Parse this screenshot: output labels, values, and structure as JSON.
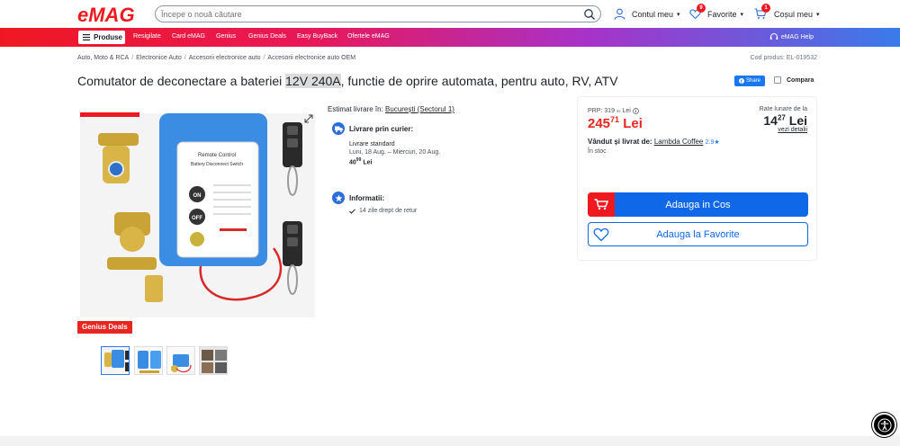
{
  "header": {
    "search_placeholder": "Începe o nouă căutare",
    "account_label": "Contul meu",
    "favorites_label": "Favorite",
    "favorites_count": "9",
    "cart_label": "Coșul meu",
    "cart_count": "1"
  },
  "nav": {
    "products_label": "Produse",
    "links": [
      "Resigilate",
      "Card eMAG",
      "Genius",
      "Genius Deals",
      "Easy BuyBack",
      "Ofertele eMAG"
    ],
    "help_label": "eMAG Help"
  },
  "breadcrumb": [
    "Auto, Moto & RCA",
    "Electronice Auto",
    "Accesorii electronice auto",
    "Accesorii electronice auto OEM"
  ],
  "product_code": "Cod produs: EL-019532",
  "title": {
    "prefix": "Comutator de deconectare a bateriei ",
    "highlight": "12V 240A",
    "suffix": ", functie de oprire automata, pentru auto, RV, ATV"
  },
  "share_label": "Share",
  "compare_label": "Compara",
  "genius_deals_label": "Genius Deals",
  "delivery": {
    "estimate_label": "Estimat livrare în:",
    "estimate_location": "București (Sectorul 1)",
    "courier_title": "Livrare prin curier:",
    "standard_label": "Livrare standard",
    "dates": "Luni, 18 Aug. – Miercuri, 20 Aug.",
    "price_main": "40",
    "price_cents": "99",
    "price_currency": "Lei",
    "info_title": "Informatii:",
    "return_text": "14 zile drept de retur"
  },
  "pricing": {
    "prp_label": "PRP: 319",
    "prp_cents": "99",
    "prp_currency": "Lei",
    "price_main": "245",
    "price_cents": "71",
    "price_currency": "Lei",
    "rate_label": "Rate lunare de la",
    "rate_main": "14",
    "rate_cents": "27",
    "rate_currency": "Lei",
    "rate_link": "vezi detalii",
    "seller_label": "Vândut și livrat de:",
    "seller_name": "Lambda Coffee",
    "seller_rating": "2.9",
    "stock": "În stoc",
    "add_to_cart": "Adauga in Cos",
    "add_to_fav": "Adauga la Favorite"
  },
  "device": {
    "line1": "Remote Control",
    "line2": "Battery Disconnect Switch",
    "on": "ON",
    "off": "OFF"
  },
  "colors": {
    "brand_red": "#ef1a20",
    "brand_blue": "#0f68e7",
    "price_red": "#e8251e"
  }
}
